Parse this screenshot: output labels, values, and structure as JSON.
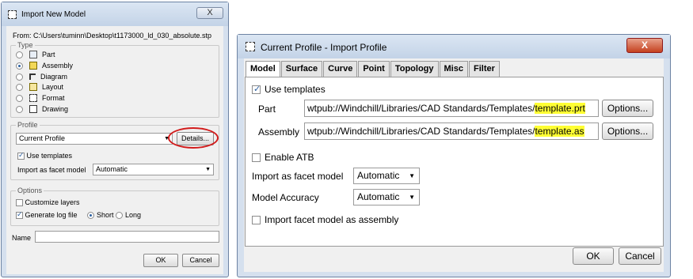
{
  "import_new_model": {
    "title": "Import New Model",
    "close_glyph": "X",
    "from_text": "From: C:\\Users\\tuminn\\Desktop\\t1173000_ld_030_absolute.stp",
    "type_group": {
      "legend": "Type",
      "options": [
        {
          "label": "Part",
          "icon": "part-icon",
          "selected": false
        },
        {
          "label": "Assembly",
          "icon": "assembly-icon",
          "selected": true
        },
        {
          "label": "Diagram",
          "icon": "diagram-icon",
          "selected": false
        },
        {
          "label": "Layout",
          "icon": "layout-icon",
          "selected": false
        },
        {
          "label": "Format",
          "icon": "format-icon",
          "selected": false
        },
        {
          "label": "Drawing",
          "icon": "drawing-icon",
          "selected": false
        }
      ]
    },
    "profile_group": {
      "legend": "Profile",
      "profile_value": "Current Profile",
      "details_label": "Details...",
      "use_templates_label": "Use templates",
      "use_templates_checked": true,
      "import_facet_label": "Import as facet model",
      "import_facet_value": "Automatic"
    },
    "options_group": {
      "legend": "Options",
      "customize_layers_label": "Customize layers",
      "customize_layers_checked": false,
      "generate_log_label": "Generate log file",
      "generate_log_checked": true,
      "short_label": "Short",
      "long_label": "Long",
      "log_mode": "Short"
    },
    "name_label": "Name",
    "name_value": "",
    "ok_label": "OK",
    "cancel_label": "Cancel",
    "annotation_color": "#d21b1b"
  },
  "current_profile": {
    "title": "Current Profile - Import Profile",
    "close_glyph": "X",
    "tabs": [
      "Model",
      "Surface",
      "Curve",
      "Point",
      "Topology",
      "Misc",
      "Filter"
    ],
    "active_tab": "Model",
    "use_templates_label": "Use templates",
    "use_templates_checked": true,
    "part_label": "Part",
    "part_path": "wtpub://Windchill/Libraries/CAD Standards/Templates/",
    "part_file": "template.prt",
    "assembly_label": "Assembly",
    "assembly_path": "wtpub://Windchill/Libraries/CAD Standards/Templates/",
    "assembly_file": "template.as",
    "options_label": "Options...",
    "enable_atb_label": "Enable ATB",
    "enable_atb_checked": false,
    "import_facet_label": "Import as facet model",
    "import_facet_value": "Automatic",
    "model_accuracy_label": "Model Accuracy",
    "model_accuracy_value": "Automatic",
    "import_facet_asm_label": "Import facet model as assembly",
    "import_facet_asm_checked": false,
    "ok_label": "OK",
    "cancel_label": "Cancel",
    "highlight_color": "#ffff33"
  }
}
